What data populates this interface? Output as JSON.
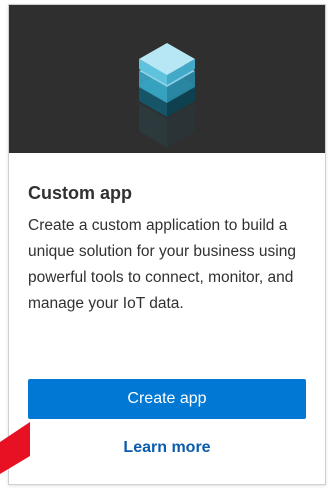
{
  "card": {
    "title": "Custom app",
    "description": "Create a custom application to build a unique solution for your business using powerful tools to connect, monitor, and manage your IoT data.",
    "primary_button_label": "Create app",
    "link_label": "Learn more",
    "hero_icon": "stacked-cube-icon"
  },
  "colors": {
    "hero_background": "#2f2f2f",
    "primary_button": "#0078d4",
    "link": "#0b5cad",
    "annotation_arrow": "#e81123"
  }
}
